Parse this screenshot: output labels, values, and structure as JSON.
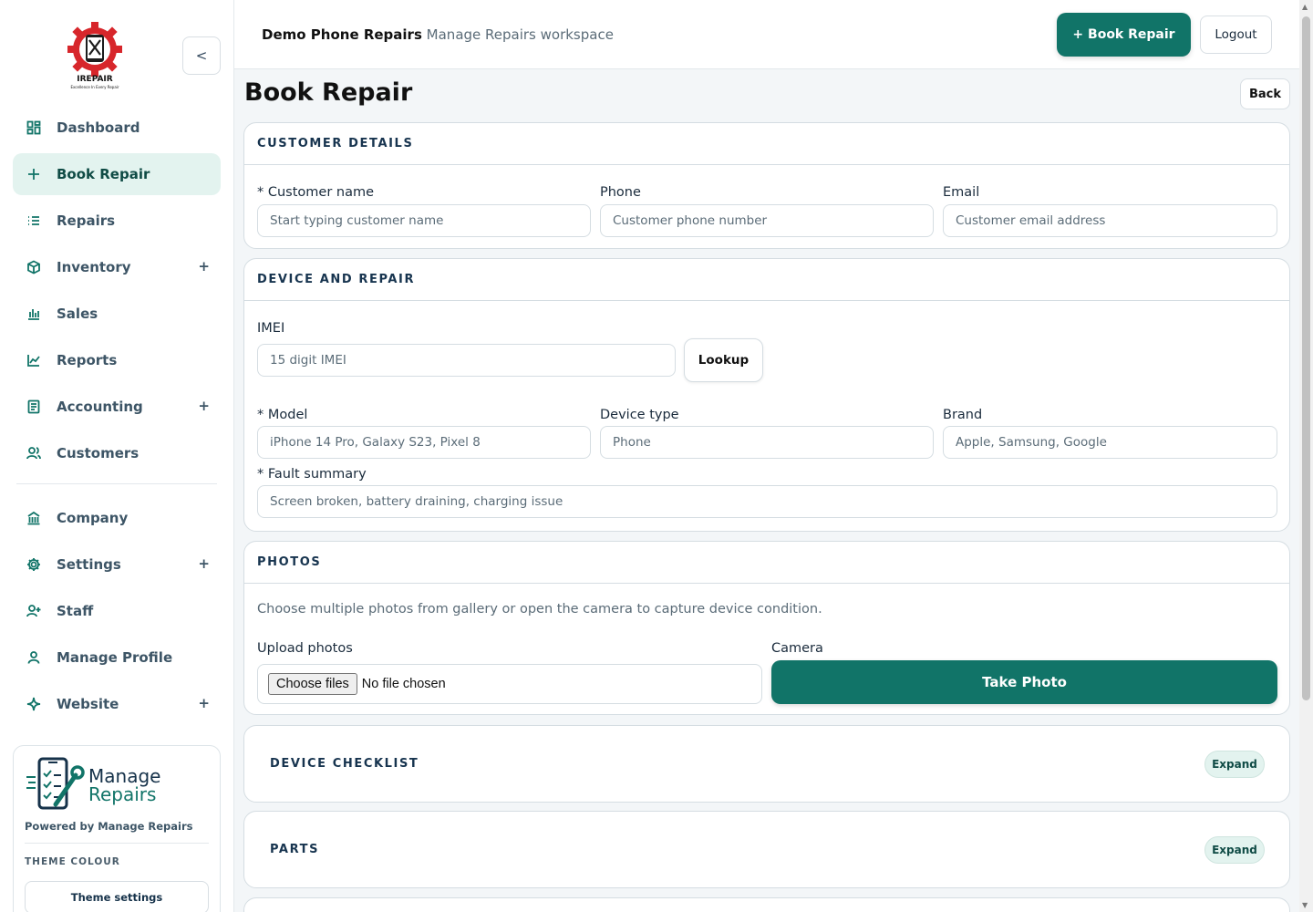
{
  "sidebar": {
    "logo": {
      "name": "IREPAIR",
      "tagline": "Excellence In Every Repair"
    },
    "collapse_label": "<",
    "items": [
      {
        "label": "Dashboard",
        "icon": "dashboard-icon",
        "expandable": false,
        "active": false
      },
      {
        "label": "Book Repair",
        "icon": "plus-icon",
        "expandable": false,
        "active": true
      },
      {
        "label": "Repairs",
        "icon": "list-icon",
        "expandable": false,
        "active": false
      },
      {
        "label": "Inventory",
        "icon": "box-icon",
        "expandable": true,
        "active": false
      },
      {
        "label": "Sales",
        "icon": "bar-chart-icon",
        "expandable": false,
        "active": false
      },
      {
        "label": "Reports",
        "icon": "line-chart-icon",
        "expandable": false,
        "active": false
      },
      {
        "label": "Accounting",
        "icon": "ledger-icon",
        "expandable": true,
        "active": false
      },
      {
        "label": "Customers",
        "icon": "users-icon",
        "expandable": false,
        "active": false
      },
      {
        "label": "Company",
        "icon": "building-icon",
        "expandable": false,
        "active": false
      },
      {
        "label": "Settings",
        "icon": "gear-icon",
        "expandable": true,
        "active": false
      },
      {
        "label": "Staff",
        "icon": "user-plus-icon",
        "expandable": false,
        "active": false
      },
      {
        "label": "Manage Profile",
        "icon": "user-icon",
        "expandable": false,
        "active": false
      },
      {
        "label": "Website",
        "icon": "sparkle-icon",
        "expandable": true,
        "active": false
      }
    ],
    "expand_symbol": "+",
    "brand": {
      "name_line1": "Manage",
      "name_line2": "Repairs",
      "powered_by": "Powered by Manage Repairs",
      "theme_label": "THEME COLOUR",
      "theme_button": "Theme settings"
    }
  },
  "header": {
    "workspace_name": "Demo Phone Repairs",
    "workspace_sub": "Manage Repairs workspace",
    "book_button": "+ Book Repair",
    "logout_button": "Logout"
  },
  "page": {
    "title": "Book Repair",
    "back_button": "Back"
  },
  "customer": {
    "heading": "CUSTOMER DETAILS",
    "name_label": "* Customer name",
    "name_placeholder": "Start typing customer name",
    "phone_label": "Phone",
    "phone_placeholder": "Customer phone number",
    "email_label": "Email",
    "email_placeholder": "Customer email address"
  },
  "device": {
    "heading": "DEVICE AND REPAIR",
    "imei_label": "IMEI",
    "imei_placeholder": "15 digit IMEI",
    "lookup_button": "Lookup",
    "model_label": "* Model",
    "model_placeholder": "iPhone 14 Pro, Galaxy S23, Pixel 8",
    "type_label": "Device type",
    "type_placeholder": "Phone",
    "brand_label": "Brand",
    "brand_placeholder": "Apple, Samsung, Google",
    "fault_label": "* Fault summary",
    "fault_placeholder": "Screen broken, battery draining, charging issue"
  },
  "photos": {
    "heading": "PHOTOS",
    "note": "Choose multiple photos from gallery or open the camera to capture device condition.",
    "upload_label": "Upload photos",
    "choose_button": "Choose files",
    "no_file": "No file chosen",
    "camera_label": "Camera",
    "camera_button": "Take Photo"
  },
  "checklist": {
    "heading": "DEVICE CHECKLIST",
    "expand": "Expand"
  },
  "parts": {
    "heading": "PARTS",
    "expand": "Expand"
  },
  "colors": {
    "accent": "#117468",
    "accent_light": "#e3f3ef",
    "heading_text": "#17344f"
  }
}
